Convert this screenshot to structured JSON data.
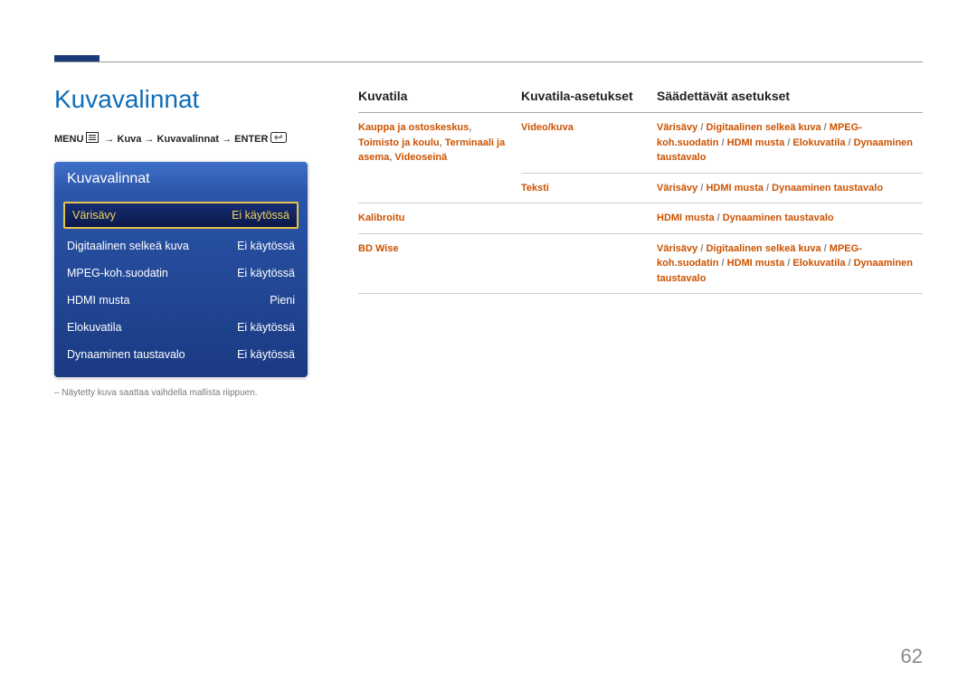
{
  "title": "Kuvavalinnat",
  "menu_path": {
    "menu": "MENU",
    "p1": "Kuva",
    "p2": "Kuvavalinnat",
    "enter": "ENTER"
  },
  "panel": {
    "header": "Kuvavalinnat",
    "rows": [
      {
        "label": "Värisävy",
        "value": "Ei käytössä",
        "selected": true
      },
      {
        "label": "Digitaalinen selkeä kuva",
        "value": "Ei käytössä",
        "selected": false
      },
      {
        "label": "MPEG-koh.suodatin",
        "value": "Ei käytössä",
        "selected": false
      },
      {
        "label": "HDMI musta",
        "value": "Pieni",
        "selected": false
      },
      {
        "label": "Elokuvatila",
        "value": "Ei käytössä",
        "selected": false
      },
      {
        "label": "Dynaaminen taustavalo",
        "value": "Ei käytössä",
        "selected": false
      }
    ]
  },
  "footnote": "Näytetty kuva saattaa vaihdella mallista riippuen.",
  "table": {
    "headers": {
      "c1": "Kuvatila",
      "c2": "Kuvatila-asetukset",
      "c3": "Säädettävät asetukset"
    },
    "rows": [
      {
        "c1_parts": [
          "Kauppa ja ostoskeskus",
          "Toimisto ja koulu",
          "Terminaali ja asema",
          "Videoseinä"
        ],
        "c2": "Video/kuva",
        "c3_parts": [
          "Värisävy",
          "Digitaalinen selkeä kuva",
          "MPEG-koh.suodatin",
          "HDMI musta",
          "Elokuvatila",
          "Dynaaminen taustavalo"
        ]
      },
      {
        "c1_parts": [],
        "c2": "Teksti",
        "c3_parts": [
          "Värisävy",
          "HDMI musta",
          "Dynaaminen taustavalo"
        ]
      },
      {
        "c1_parts": [
          "Kalibroitu"
        ],
        "c2": "",
        "c3_parts": [
          "HDMI musta",
          "Dynaaminen taustavalo"
        ]
      },
      {
        "c1_parts": [
          "BD Wise"
        ],
        "c2": "",
        "c3_parts": [
          "Värisävy",
          "Digitaalinen selkeä kuva",
          "MPEG-koh.suodatin",
          "HDMI musta",
          "Elokuvatila",
          "Dynaaminen taustavalo"
        ]
      }
    ]
  },
  "page_number": "62"
}
